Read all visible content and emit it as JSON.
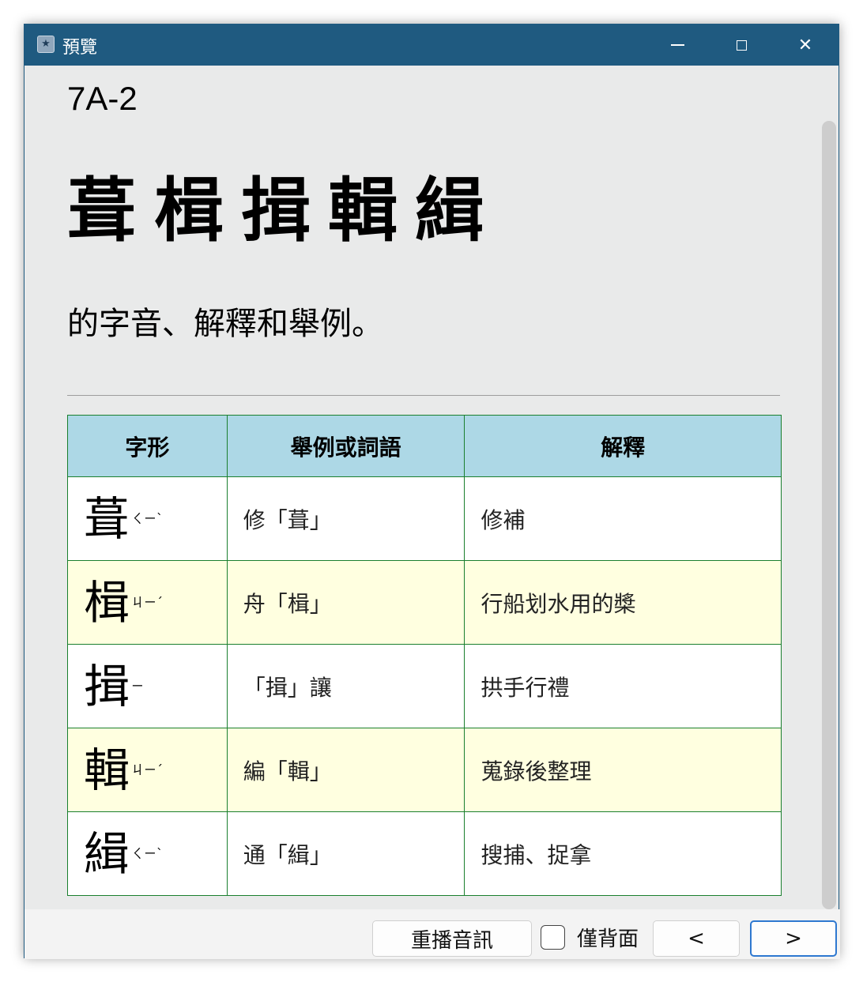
{
  "window": {
    "title": "預覽",
    "minimize": "─",
    "maximize": "□",
    "close": "✕"
  },
  "card": {
    "code": "7A-2",
    "chars": "葺楫揖輯緝",
    "subtitle": "的字音、解釋和舉例。"
  },
  "table": {
    "headers": [
      "字形",
      "舉例或詞語",
      "解釋"
    ],
    "rows": [
      {
        "glyph": "葺",
        "zhuyin": "ㄑㄧˋ",
        "example": "修「葺」",
        "meaning": "修補"
      },
      {
        "glyph": "楫",
        "zhuyin": "ㄐㄧˊ",
        "example": "舟「楫」",
        "meaning": "行船划水用的槳"
      },
      {
        "glyph": "揖",
        "zhuyin": "ㄧ",
        "example": "「揖」讓",
        "meaning": "拱手行禮"
      },
      {
        "glyph": "輯",
        "zhuyin": "ㄐㄧˊ",
        "example": "編「輯」",
        "meaning": "蒐錄後整理"
      },
      {
        "glyph": "緝",
        "zhuyin": "ㄑㄧˋ",
        "example": "通「緝」",
        "meaning": "搜捕、捉拿"
      }
    ]
  },
  "controls": {
    "replay_label": "重播音訊",
    "back_only_label": "僅背面",
    "back_only_checked": false,
    "prev_label": "<",
    "next_label": ">"
  }
}
